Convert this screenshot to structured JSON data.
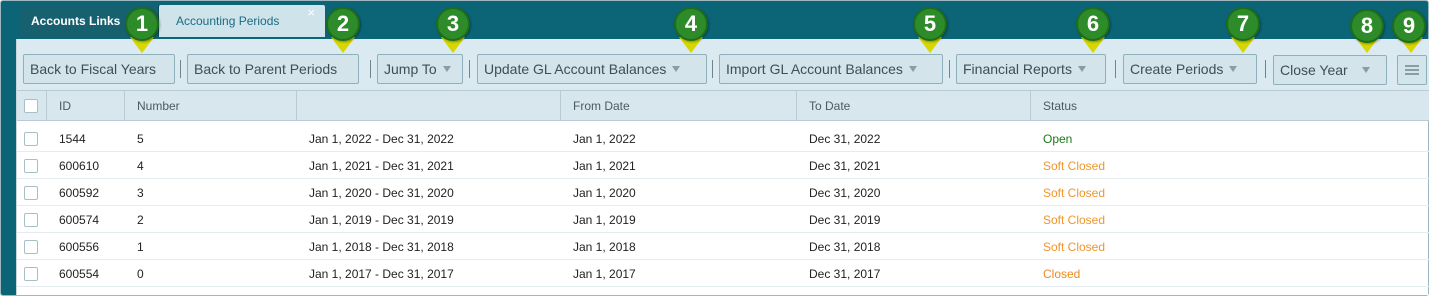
{
  "tabs": {
    "links_label": "Accounts Links",
    "periods_label": "Accounting Periods",
    "close_glyph": "×"
  },
  "toolbar": {
    "back_fiscal": "Back to Fiscal Years",
    "back_parent": "Back to Parent Periods",
    "jump_to": "Jump To",
    "update_gl": "Update GL Account Balances",
    "import_gl": "Import GL Account Balances",
    "financial_reports": "Financial Reports",
    "create_periods": "Create Periods",
    "close_year": "Close Year"
  },
  "markers": [
    "1",
    "2",
    "3",
    "4",
    "5",
    "6",
    "7",
    "8",
    "9"
  ],
  "columns": {
    "id": "ID",
    "number": "Number",
    "range": "",
    "from": "From Date",
    "to": "To Date",
    "status": "Status"
  },
  "rows": [
    {
      "id": "1544",
      "number": "5",
      "range": "Jan 1, 2022 - Dec 31, 2022",
      "from": "Jan 1, 2022",
      "to": "Dec 31, 2022",
      "status": "Open"
    },
    {
      "id": "600610",
      "number": "4",
      "range": "Jan 1, 2021 - Dec 31, 2021",
      "from": "Jan 1, 2021",
      "to": "Dec 31, 2021",
      "status": "Soft Closed"
    },
    {
      "id": "600592",
      "number": "3",
      "range": "Jan 1, 2020 - Dec 31, 2020",
      "from": "Jan 1, 2020",
      "to": "Dec 31, 2020",
      "status": "Soft Closed"
    },
    {
      "id": "600574",
      "number": "2",
      "range": "Jan 1, 2019 - Dec 31, 2019",
      "from": "Jan 1, 2019",
      "to": "Dec 31, 2019",
      "status": "Soft Closed"
    },
    {
      "id": "600556",
      "number": "1",
      "range": "Jan 1, 2018 - Dec 31, 2018",
      "from": "Jan 1, 2018",
      "to": "Dec 31, 2018",
      "status": "Soft Closed"
    },
    {
      "id": "600554",
      "number": "0",
      "range": "Jan 1, 2017 - Dec 31, 2017",
      "from": "Jan 1, 2017",
      "to": "Dec 31, 2017",
      "status": "Closed"
    }
  ],
  "colors": {
    "frame": "#0b6577",
    "marker": "#2e8b2a",
    "arrow": "#d6d600",
    "status_open": "#1a7a1a",
    "status_soft_closed": "#f0962a",
    "status_closed": "#f08a1a"
  },
  "icons": {
    "menu": "hamburger-menu-icon",
    "caret": "caret-down-icon",
    "close": "close-icon",
    "checkbox": "checkbox"
  }
}
